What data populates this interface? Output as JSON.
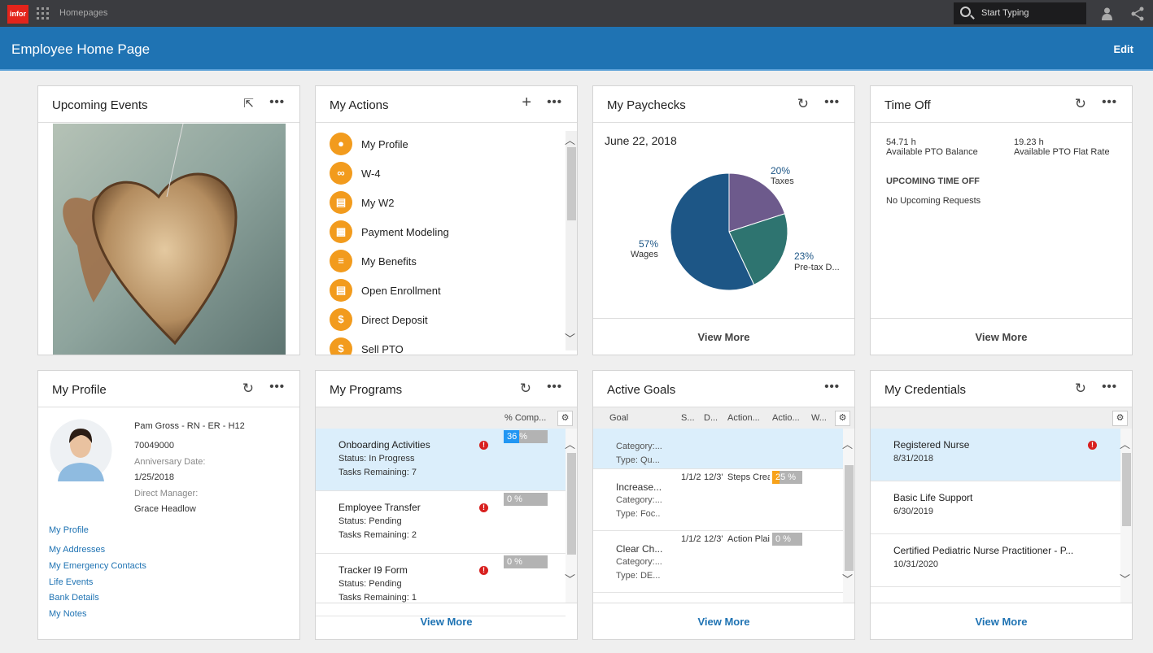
{
  "topbar": {
    "logo": "infor",
    "breadcrumb": "Homepages",
    "search_placeholder": "Start Typing"
  },
  "header": {
    "title": "Employee Home Page",
    "edit": "Edit"
  },
  "upcoming_events": {
    "title": "Upcoming Events"
  },
  "my_actions": {
    "title": "My Actions",
    "items": [
      {
        "label": "My Profile",
        "icon": "user-icon"
      },
      {
        "label": "W-4",
        "icon": "link-icon"
      },
      {
        "label": "My W2",
        "icon": "document-icon"
      },
      {
        "label": "Payment Modeling",
        "icon": "calculator-icon"
      },
      {
        "label": "My Benefits",
        "icon": "list-icon"
      },
      {
        "label": "Open Enrollment",
        "icon": "document-icon"
      },
      {
        "label": "Direct Deposit",
        "icon": "dollar-icon"
      },
      {
        "label": "Sell PTO",
        "icon": "dollar-icon"
      }
    ]
  },
  "my_paychecks": {
    "title": "My Paychecks",
    "date": "June 22, 2018",
    "view_more": "View More",
    "chart_data": {
      "type": "pie",
      "slices": [
        {
          "label": "Taxes",
          "value": 20,
          "pct": "20%",
          "color": "#6d5a8c"
        },
        {
          "label": "Pre-tax D...",
          "value": 23,
          "pct": "23%",
          "color": "#2e7470"
        },
        {
          "label": "Wages",
          "value": 57,
          "pct": "57%",
          "color": "#1d5686"
        }
      ]
    }
  },
  "time_off": {
    "title": "Time Off",
    "balance_value": "54.71 h",
    "balance_label": "Available PTO Balance",
    "flat_value": "19.23 h",
    "flat_label": "Available PTO Flat Rate",
    "upcoming_heading": "UPCOMING TIME OFF",
    "upcoming_text": "No Upcoming Requests",
    "view_more": "View More"
  },
  "my_profile": {
    "title": "My Profile",
    "name": "Pam Gross - RN - ER - H12",
    "id": "70049000",
    "anniversary_label": "Anniversary Date:",
    "anniversary": "1/25/2018",
    "manager_label": "Direct Manager:",
    "manager": "Grace Headlow",
    "links": [
      "My Profile",
      "My Addresses",
      "My Emergency Contacts",
      "Life Events",
      "Bank Details",
      "My Notes"
    ]
  },
  "my_programs": {
    "title": "My Programs",
    "column": "% Comp...",
    "view_more": "View More",
    "rows": [
      {
        "name": "Onboarding Activities",
        "status": "Status: In Progress",
        "tasks": "Tasks Remaining: 7",
        "progress": 36,
        "label": "36 %"
      },
      {
        "name": "Employee Transfer",
        "status": "Status: Pending",
        "tasks": "Tasks Remaining: 2",
        "progress": 0,
        "label": "0 %"
      },
      {
        "name": "Tracker I9 Form",
        "status": "Status: Pending",
        "tasks": "Tasks Remaining: 1",
        "progress": 0,
        "label": "0 %"
      }
    ]
  },
  "active_goals": {
    "title": "Active Goals",
    "columns": [
      "Goal",
      "S...",
      "D...",
      "Action...",
      "Actio...",
      "W..."
    ],
    "view_more": "View More",
    "rows": [
      {
        "name": "",
        "category": "Category:...",
        "type": "Type: Qu...",
        "start": "",
        "due": "",
        "action": "",
        "progress": null,
        "label": ""
      },
      {
        "name": "Increase...",
        "category": "Category:...",
        "type": "Type: Foc..",
        "start": "1/1/2",
        "due": "12/3'",
        "action": "Steps Crea",
        "progress": 25,
        "label": "25 %"
      },
      {
        "name": "Clear Ch...",
        "category": "Category:...",
        "type": "Type: DE...",
        "start": "1/1/2",
        "due": "12/3'",
        "action": "Action Plai",
        "progress": 0,
        "label": "0 %"
      }
    ]
  },
  "my_credentials": {
    "title": "My Credentials",
    "view_more": "View More",
    "rows": [
      {
        "name": "Registered Nurse",
        "date": "8/31/2018",
        "alert": true
      },
      {
        "name": "Basic Life Support",
        "date": "6/30/2019",
        "alert": false
      },
      {
        "name": "Certified Pediatric Nurse Practitioner - P...",
        "date": "10/31/2020",
        "alert": false
      }
    ]
  },
  "colors": {
    "brand_blue": "#1f73b3",
    "action_orange": "#f29b1d",
    "progress_blue": "#2196f3",
    "progress_orange": "#f7a21b",
    "alert_red": "#d8201f"
  }
}
